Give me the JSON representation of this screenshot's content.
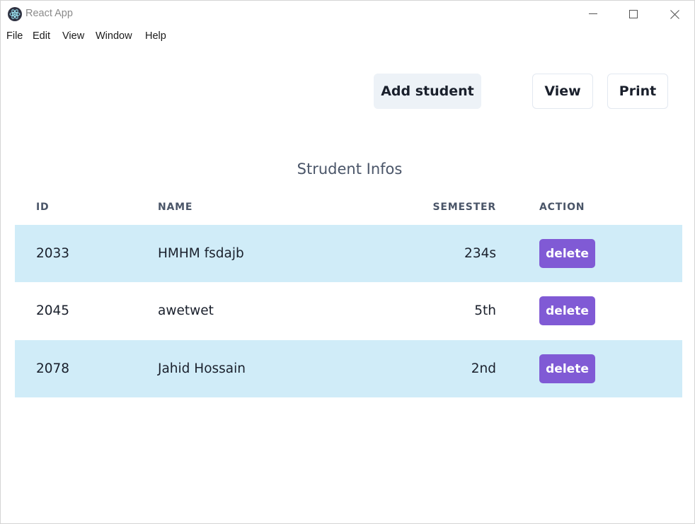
{
  "window": {
    "title": "React App"
  },
  "menu": {
    "items": [
      "File",
      "Edit",
      "View",
      "Window",
      "Help"
    ]
  },
  "toolbar": {
    "add_label": "Add student",
    "view_label": "View",
    "print_label": "Print"
  },
  "table": {
    "title": "Strudent Infos",
    "headers": [
      "ID",
      "NAME",
      "SEMESTER",
      "ACTION"
    ],
    "rows": [
      {
        "id": "2033",
        "name": "HMHM fsdajb",
        "semester": "234s",
        "action": "delete"
      },
      {
        "id": "2045",
        "name": "awetwet",
        "semester": "5th",
        "action": "delete"
      },
      {
        "id": "2078",
        "name": "Jahid Hossain",
        "semester": "2nd",
        "action": "delete"
      }
    ]
  },
  "colors": {
    "stripe": "#d0ecf8",
    "delete_button": "#805ad5",
    "add_button_bg": "#edf2f7",
    "header_text": "#4a5568"
  }
}
